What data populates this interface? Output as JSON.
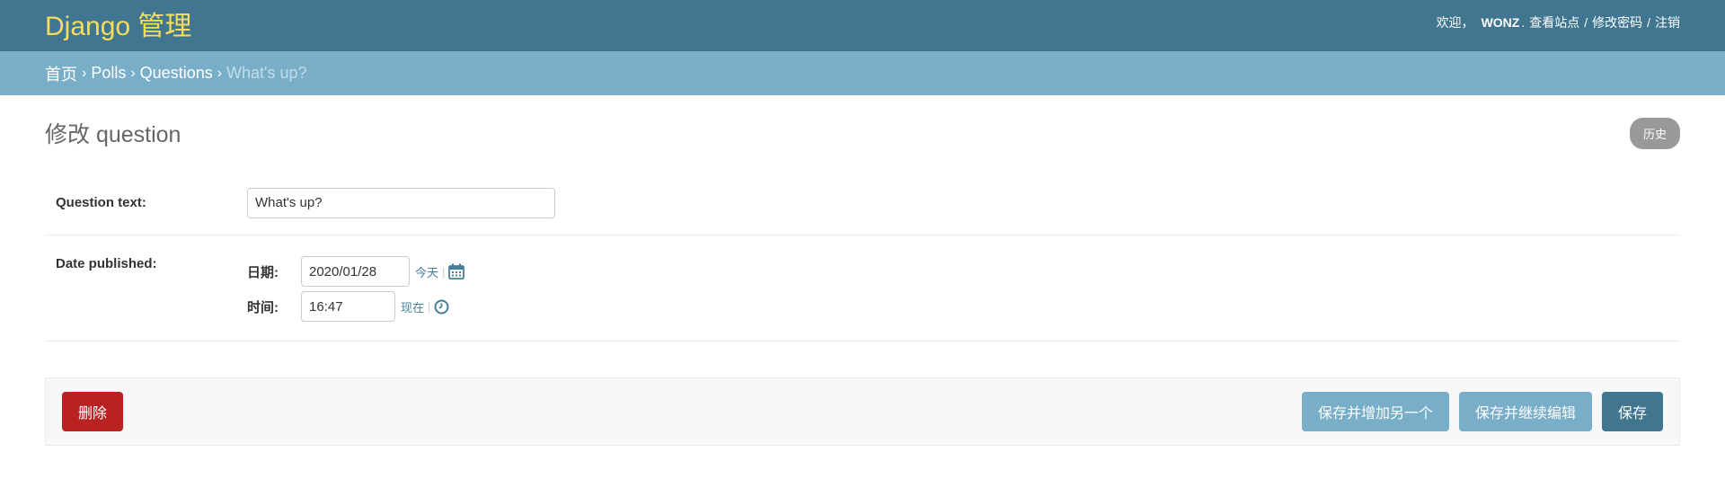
{
  "header": {
    "site_name": "Django 管理",
    "welcome": "欢迎，",
    "username": "WONZ",
    "view_site": "查看站点",
    "change_password": "修改密码",
    "logout": "注销",
    "separator": "/"
  },
  "breadcrumbs": {
    "home": "首页",
    "app": "Polls",
    "model": "Questions",
    "current": "What's up?",
    "arrow": "›"
  },
  "page": {
    "title": "修改 question",
    "history_label": "历史"
  },
  "form": {
    "question_text": {
      "label": "Question text:",
      "value": "What's up?"
    },
    "date_published": {
      "label": "Date published:",
      "date_label": "日期:",
      "date_value": "2020/01/28",
      "today_label": "今天",
      "time_label": "时间:",
      "time_value": "16:47",
      "now_label": "现在",
      "pipe": "|"
    }
  },
  "actions": {
    "delete": "删除",
    "save_add_another": "保存并增加另一个",
    "save_continue": "保存并继续编辑",
    "save": "保存"
  },
  "colors": {
    "header_bg": "#417690",
    "breadcrumb_bg": "#79aec8",
    "site_name": "#f5dd5d",
    "delete_bg": "#ba2121",
    "link": "#447e9b"
  },
  "icons": {
    "calendar": "calendar-icon",
    "clock": "clock-icon"
  }
}
